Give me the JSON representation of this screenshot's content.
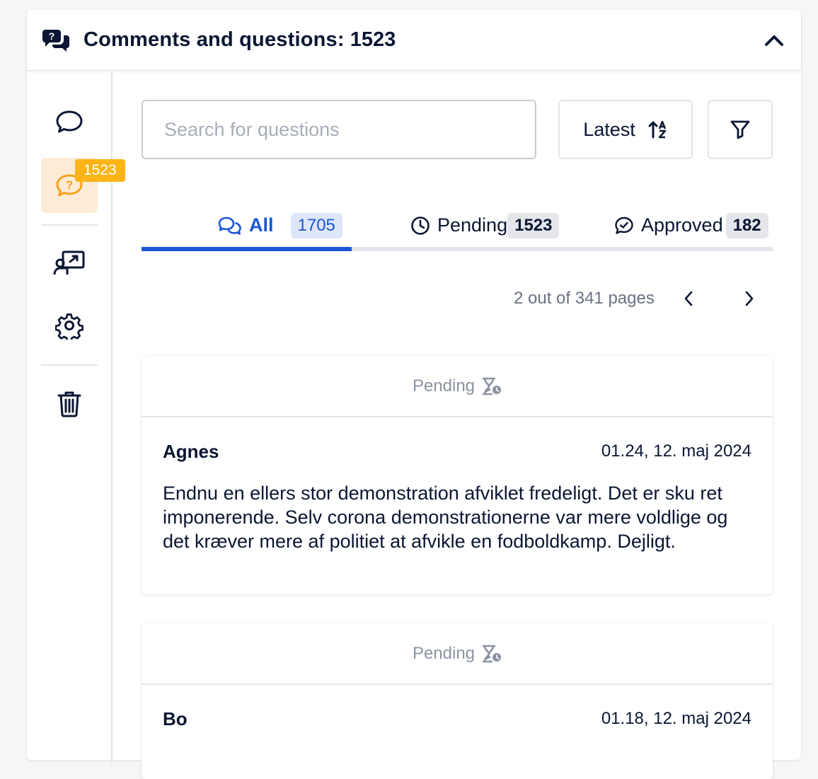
{
  "header": {
    "title": "Comments and questions:",
    "count": "1523"
  },
  "sidebar": {
    "badge": "1523",
    "items": [
      {
        "name": "comments",
        "icon": "chat-bubble-icon"
      },
      {
        "name": "questions",
        "icon": "question-bubble-icon",
        "active": true
      },
      {
        "name": "presentation",
        "icon": "presenter-icon"
      },
      {
        "name": "settings",
        "icon": "gear-icon"
      },
      {
        "name": "delete",
        "icon": "trash-icon"
      }
    ]
  },
  "toolbar": {
    "search_placeholder": "Search for questions",
    "sort_label": "Latest"
  },
  "tabs": [
    {
      "label": "All",
      "count": "1705",
      "active": true
    },
    {
      "label": "Pending",
      "count": "1523"
    },
    {
      "label": "Approved",
      "count": "182"
    }
  ],
  "pager": {
    "text": "2 out of 341 pages"
  },
  "cards": [
    {
      "status": "Pending",
      "author": "Agnes",
      "timestamp": "01.24, 12. maj 2024",
      "text": "Endnu en ellers stor demonstration afviklet fredeligt. Det er sku ret imponerende. Selv corona demonstrationerne var mere voldlige og det kræver mere af politiet at afvikle en fodboldkamp. Dejligt."
    },
    {
      "status": "Pending",
      "author": "Bo",
      "timestamp": "01.18, 12. maj 2024",
      "text": ""
    }
  ],
  "colors": {
    "accent": "#1a55d6",
    "badge": "#fbb415",
    "active_side_bg": "#fdebd6",
    "question_icon": "#f7a21b"
  }
}
